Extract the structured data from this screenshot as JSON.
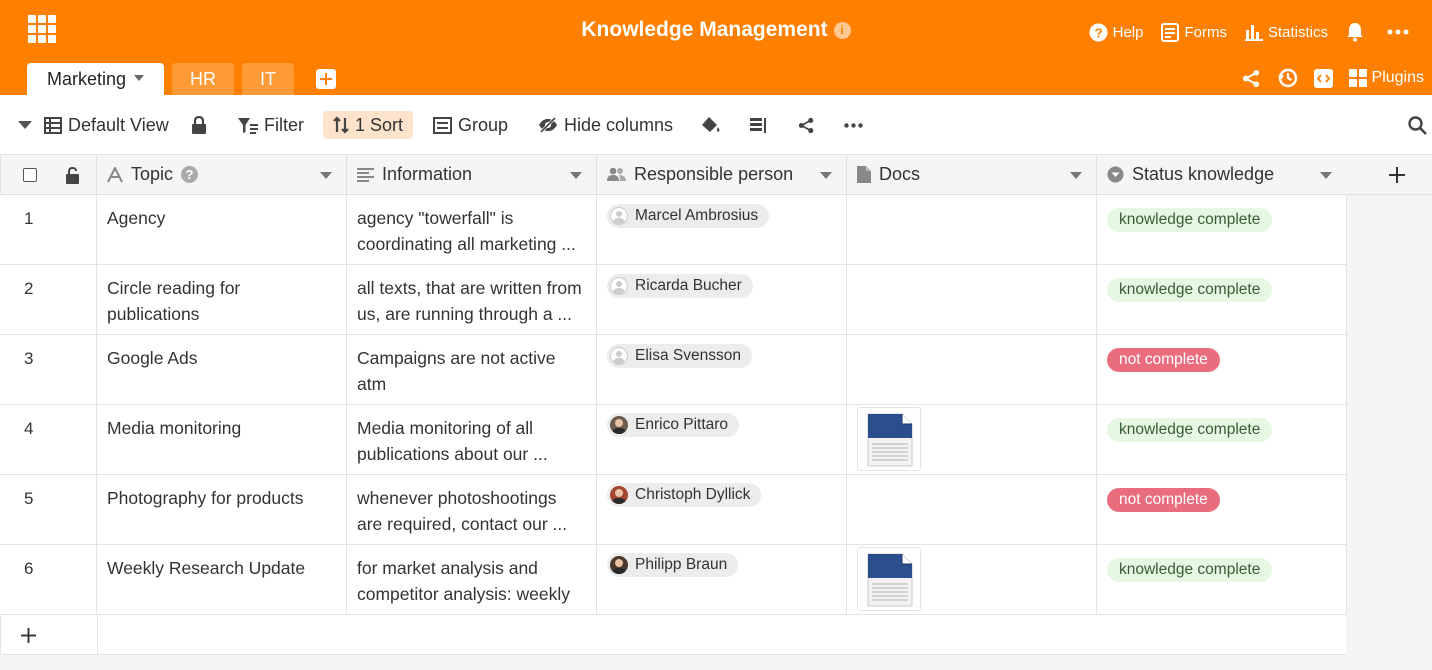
{
  "app": {
    "title": "Knowledge Management"
  },
  "top_actions": {
    "help": "Help",
    "forms": "Forms",
    "statistics": "Statistics"
  },
  "tabs": [
    {
      "label": "Marketing"
    },
    {
      "label": "HR"
    },
    {
      "label": "IT"
    }
  ],
  "tab_right": {
    "plugins": "Plugins"
  },
  "toolbar": {
    "view": "Default View",
    "filter": "Filter",
    "sort": "1 Sort",
    "group": "Group",
    "hide_columns": "Hide columns"
  },
  "columns": [
    {
      "label": "Topic"
    },
    {
      "label": "Information"
    },
    {
      "label": "Responsible person"
    },
    {
      "label": "Docs"
    },
    {
      "label": "Status knowledge"
    }
  ],
  "rows": [
    {
      "num": "1",
      "topic": "Agency",
      "info": "agency \"towerfall\" is coordinating all marketing ...",
      "person": "Marcel Ambrosius",
      "avatar": "blank",
      "doc": false,
      "status": "knowledge complete",
      "status_kind": "ok"
    },
    {
      "num": "2",
      "topic": "Circle reading for publications",
      "info": "all texts, that are written from us, are running through a ...",
      "person": "Ricarda Bucher",
      "avatar": "blank",
      "doc": false,
      "status": "knowledge complete",
      "status_kind": "ok"
    },
    {
      "num": "3",
      "topic": "Google Ads",
      "info": "Campaigns are not active atm",
      "person": "Elisa Svensson",
      "avatar": "blank",
      "doc": false,
      "status": "not complete",
      "status_kind": "bad"
    },
    {
      "num": "4",
      "topic": "Media monitoring",
      "info": "Media monitoring of all publications about our ...",
      "person": "Enrico Pittaro",
      "avatar": "photo",
      "doc": true,
      "status": "knowledge complete",
      "status_kind": "ok"
    },
    {
      "num": "5",
      "topic": "Photography for products",
      "info": "whenever photoshootings are required, contact our ...",
      "person": "Christoph Dyllick",
      "avatar": "photo",
      "doc": false,
      "status": "not complete",
      "status_kind": "bad"
    },
    {
      "num": "6",
      "topic": "Weekly Research Update",
      "info": "for market analysis and competitor analysis: weekly ...",
      "person": "Philipp Braun",
      "avatar": "photo",
      "doc": true,
      "status": "knowledge complete",
      "status_kind": "ok"
    }
  ],
  "colors": {
    "brand": "#ff8000",
    "tab_inactive": "#ff9b36",
    "tag_ok_bg": "#e6f8e2",
    "tag_bad_bg": "#ea6d7e",
    "sort_bg": "#fde2cc"
  }
}
